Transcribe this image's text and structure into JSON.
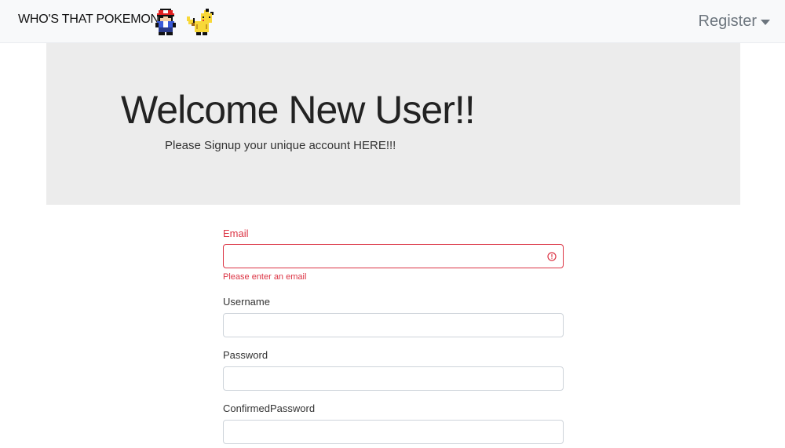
{
  "navbar": {
    "brand": "WHO'S THAT POKEMON",
    "register_label": "Register",
    "sprites": [
      "trainer-sprite",
      "pikachu-sprite"
    ]
  },
  "hero": {
    "title": "Welcome New User!!",
    "subtitle": "Please Signup your unique account HERE!!!"
  },
  "form": {
    "email": {
      "label": "Email",
      "value": "",
      "error": "Please enter an email"
    },
    "username": {
      "label": "Username",
      "value": ""
    },
    "password": {
      "label": "Password",
      "value": ""
    },
    "confirm_password": {
      "label": "ConfirmedPassword",
      "value": ""
    }
  },
  "colors": {
    "navbar_bg": "#f8f9fa",
    "hero_bg": "#ececec",
    "error": "#dc3545",
    "input_border": "#ced4da"
  }
}
